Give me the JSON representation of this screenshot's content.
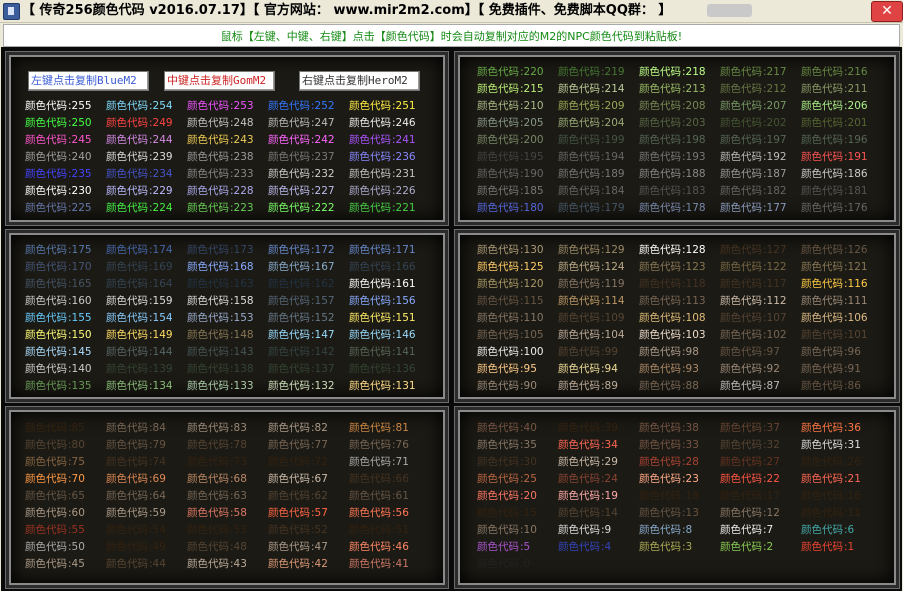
{
  "window": {
    "title": "【 传奇256颜色代码 v2016.07.17】【 官方网站：  www.mir2m2.com】【 免费插件、免费脚本QQ群：          】",
    "close_label": "✕"
  },
  "hint": "鼠标【左键、中键、右键】点击【颜色代码】时会自动复制对应的M2的NPC颜色代码到粘贴板!",
  "buttons": [
    {
      "label": "左键点击复制BlueM2"
    },
    {
      "label": "中键点击复制GomM2"
    },
    {
      "label": "右键点击复制HeroM2"
    }
  ],
  "code_prefix": "颜色代码",
  "color_codes": [
    {
      "value": 255,
      "color": "#ffffff"
    },
    {
      "value": 254,
      "color": "#7fdcff"
    },
    {
      "value": 253,
      "color": "#ee55ff"
    },
    {
      "value": 252,
      "color": "#3377ff"
    },
    {
      "value": 251,
      "color": "#ffee44"
    },
    {
      "value": 250,
      "color": "#44ff44"
    },
    {
      "value": 249,
      "color": "#ff4444"
    },
    {
      "value": 248,
      "color": "#c4c4c4"
    },
    {
      "value": 247,
      "color": "#bbbbbb"
    },
    {
      "value": 246,
      "color": "#eeeeee"
    },
    {
      "value": 245,
      "color": "#ff55cc"
    },
    {
      "value": 244,
      "color": "#d58ae6"
    },
    {
      "value": 243,
      "color": "#eecc55"
    },
    {
      "value": 242,
      "color": "#ff66ff"
    },
    {
      "value": 241,
      "color": "#aa55ff"
    },
    {
      "value": 240,
      "color": "#a0a0a0"
    },
    {
      "value": 239,
      "color": "#dddddd"
    },
    {
      "value": 238,
      "color": "#9a9a9a"
    },
    {
      "value": 237,
      "color": "#7a7a7a"
    },
    {
      "value": 236,
      "color": "#8888ff"
    },
    {
      "value": 235,
      "color": "#4444ff"
    },
    {
      "value": 234,
      "color": "#4455cc"
    },
    {
      "value": 233,
      "color": "#888888"
    },
    {
      "value": 232,
      "color": "#cccccc"
    },
    {
      "value": 231,
      "color": "#c4c4c4"
    },
    {
      "value": 230,
      "color": "#ffffff"
    },
    {
      "value": 229,
      "color": "#bbbbff"
    },
    {
      "value": 228,
      "color": "#aaaaee"
    },
    {
      "value": 227,
      "color": "#bbbbee"
    },
    {
      "value": 226,
      "color": "#aaaacc"
    },
    {
      "value": 225,
      "color": "#6677aa"
    },
    {
      "value": 224,
      "color": "#44ee44"
    },
    {
      "value": 223,
      "color": "#66cc55"
    },
    {
      "value": 222,
      "color": "#77ff66"
    },
    {
      "value": 221,
      "color": "#44cc44"
    },
    {
      "value": 220,
      "color": "#66aa44"
    },
    {
      "value": 219,
      "color": "#447733"
    },
    {
      "value": 218,
      "color": "#bbff88"
    },
    {
      "value": 217,
      "color": "#668844"
    },
    {
      "value": 216,
      "color": "#668844"
    },
    {
      "value": 215,
      "color": "#bbee77"
    },
    {
      "value": 214,
      "color": "#bbcc99"
    },
    {
      "value": 213,
      "color": "#99bb66"
    },
    {
      "value": 212,
      "color": "#667744"
    },
    {
      "value": 211,
      "color": "#889966"
    },
    {
      "value": 210,
      "color": "#aabb88"
    },
    {
      "value": 209,
      "color": "#99aa55"
    },
    {
      "value": 208,
      "color": "#778855"
    },
    {
      "value": 207,
      "color": "#779966"
    },
    {
      "value": 206,
      "color": "#aaee88"
    },
    {
      "value": 205,
      "color": "#889988"
    },
    {
      "value": 204,
      "color": "#99aa77"
    },
    {
      "value": 203,
      "color": "#556644"
    },
    {
      "value": 202,
      "color": "#445533"
    },
    {
      "value": 201,
      "color": "#556633"
    },
    {
      "value": 200,
      "color": "#778866"
    },
    {
      "value": 199,
      "color": "#445544"
    },
    {
      "value": 198,
      "color": "#556655"
    },
    {
      "value": 197,
      "color": "#556655"
    },
    {
      "value": 196,
      "color": "#556655"
    },
    {
      "value": 195,
      "color": "#444444"
    },
    {
      "value": 194,
      "color": "#666666"
    },
    {
      "value": 193,
      "color": "#777777"
    },
    {
      "value": 192,
      "color": "#bbbbbb"
    },
    {
      "value": 191,
      "color": "#ff5555"
    },
    {
      "value": 190,
      "color": "#666666"
    },
    {
      "value": 189,
      "color": "#777777"
    },
    {
      "value": 188,
      "color": "#888888"
    },
    {
      "value": 187,
      "color": "#999999"
    },
    {
      "value": 186,
      "color": "#cccccc"
    },
    {
      "value": 185,
      "color": "#777777"
    },
    {
      "value": 184,
      "color": "#666666"
    },
    {
      "value": 183,
      "color": "#555555"
    },
    {
      "value": 182,
      "color": "#666666"
    },
    {
      "value": 181,
      "color": "#555555"
    },
    {
      "value": 180,
      "color": "#5566dd"
    },
    {
      "value": 179,
      "color": "#445566"
    },
    {
      "value": 178,
      "color": "#7788aa"
    },
    {
      "value": 177,
      "color": "#8899bb"
    },
    {
      "value": 176,
      "color": "#666666"
    },
    {
      "value": 175,
      "color": "#5577aa"
    },
    {
      "value": 174,
      "color": "#4466aa"
    },
    {
      "value": 173,
      "color": "#334466"
    },
    {
      "value": 172,
      "color": "#6688cc"
    },
    {
      "value": 171,
      "color": "#6688cc"
    },
    {
      "value": 170,
      "color": "#445577"
    },
    {
      "value": 169,
      "color": "#334455"
    },
    {
      "value": 168,
      "color": "#88aaff"
    },
    {
      "value": 167,
      "color": "#88aacc"
    },
    {
      "value": 166,
      "color": "#334455"
    },
    {
      "value": 165,
      "color": "#445566"
    },
    {
      "value": 164,
      "color": "#334455"
    },
    {
      "value": 163,
      "color": "#223344"
    },
    {
      "value": 162,
      "color": "#223344"
    },
    {
      "value": 161,
      "color": "#ffffff"
    },
    {
      "value": 160,
      "color": "#cccccc"
    },
    {
      "value": 159,
      "color": "#dddddd"
    },
    {
      "value": 158,
      "color": "#dddddd"
    },
    {
      "value": 157,
      "color": "#556677"
    },
    {
      "value": 156,
      "color": "#88aaff"
    },
    {
      "value": 155,
      "color": "#66ccff"
    },
    {
      "value": 154,
      "color": "#88ccff"
    },
    {
      "value": 153,
      "color": "#99aacc"
    },
    {
      "value": 152,
      "color": "#667788"
    },
    {
      "value": 151,
      "color": "#ffee66"
    },
    {
      "value": 150,
      "color": "#ffff77"
    },
    {
      "value": 149,
      "color": "#ffdd66"
    },
    {
      "value": 148,
      "color": "#887755"
    },
    {
      "value": 147,
      "color": "#99ddff"
    },
    {
      "value": 146,
      "color": "#99ddff"
    },
    {
      "value": 145,
      "color": "#aaddff"
    },
    {
      "value": 144,
      "color": "#556666"
    },
    {
      "value": 143,
      "color": "#445555"
    },
    {
      "value": 142,
      "color": "#334444"
    },
    {
      "value": 141,
      "color": "#556655"
    },
    {
      "value": 140,
      "color": "#cccccc"
    },
    {
      "value": 139,
      "color": "#334433"
    },
    {
      "value": 138,
      "color": "#334433"
    },
    {
      "value": 137,
      "color": "#334433"
    },
    {
      "value": 136,
      "color": "#334433"
    },
    {
      "value": 135,
      "color": "#669955"
    },
    {
      "value": 134,
      "color": "#88bb77"
    },
    {
      "value": 133,
      "color": "#aaccaa"
    },
    {
      "value": 132,
      "color": "#ccddbb"
    },
    {
      "value": 131,
      "color": "#ffdd88"
    },
    {
      "value": 130,
      "color": "#aa9977"
    },
    {
      "value": 129,
      "color": "#998866"
    },
    {
      "value": 128,
      "color": "#ffffff"
    },
    {
      "value": 127,
      "color": "#443322"
    },
    {
      "value": 126,
      "color": "#665544"
    },
    {
      "value": 125,
      "color": "#ffcc66"
    },
    {
      "value": 124,
      "color": "#bbaa88"
    },
    {
      "value": 123,
      "color": "#887755"
    },
    {
      "value": 122,
      "color": "#776644"
    },
    {
      "value": 121,
      "color": "#887755"
    },
    {
      "value": 120,
      "color": "#aa9966"
    },
    {
      "value": 119,
      "color": "#887766"
    },
    {
      "value": 118,
      "color": "#443322"
    },
    {
      "value": 117,
      "color": "#443322"
    },
    {
      "value": 116,
      "color": "#ffcc44"
    },
    {
      "value": 115,
      "color": "#665544"
    },
    {
      "value": 114,
      "color": "#bb9966"
    },
    {
      "value": 113,
      "color": "#776655"
    },
    {
      "value": 112,
      "color": "#ccbbaa"
    },
    {
      "value": 111,
      "color": "#998877"
    },
    {
      "value": 110,
      "color": "#887766"
    },
    {
      "value": 109,
      "color": "#554433"
    },
    {
      "value": 108,
      "color": "#ddbb77"
    },
    {
      "value": 107,
      "color": "#554433"
    },
    {
      "value": 106,
      "color": "#ddbb88"
    },
    {
      "value": 105,
      "color": "#776655"
    },
    {
      "value": 104,
      "color": "#bbaa99"
    },
    {
      "value": 103,
      "color": "#eeddcc"
    },
    {
      "value": 102,
      "color": "#776655"
    },
    {
      "value": 101,
      "color": "#554433"
    },
    {
      "value": 100,
      "color": "#eeeeee"
    },
    {
      "value": 99,
      "color": "#554433"
    },
    {
      "value": 98,
      "color": "#aa9988"
    },
    {
      "value": 97,
      "color": "#665544"
    },
    {
      "value": 96,
      "color": "#776655"
    },
    {
      "value": 95,
      "color": "#ffcc88"
    },
    {
      "value": 94,
      "color": "#eedd99"
    },
    {
      "value": 93,
      "color": "#aa8866"
    },
    {
      "value": 92,
      "color": "#998877"
    },
    {
      "value": 91,
      "color": "#776655"
    },
    {
      "value": 90,
      "color": "#998877"
    },
    {
      "value": 89,
      "color": "#bbaa99"
    },
    {
      "value": 88,
      "color": "#776655"
    },
    {
      "value": 87,
      "color": "#bbbbbb"
    },
    {
      "value": 86,
      "color": "#665544"
    },
    {
      "value": 85,
      "color": "#332211"
    },
    {
      "value": 84,
      "color": "#776655"
    },
    {
      "value": 83,
      "color": "#998877"
    },
    {
      "value": 82,
      "color": "#aa9988"
    },
    {
      "value": 81,
      "color": "#cc8844"
    },
    {
      "value": 80,
      "color": "#554433"
    },
    {
      "value": 79,
      "color": "#665544"
    },
    {
      "value": 78,
      "color": "#554433"
    },
    {
      "value": 77,
      "color": "#776655"
    },
    {
      "value": 76,
      "color": "#776655"
    },
    {
      "value": 75,
      "color": "#886644"
    },
    {
      "value": 74,
      "color": "#443322"
    },
    {
      "value": 73,
      "color": "#332211"
    },
    {
      "value": 72,
      "color": "#332211"
    },
    {
      "value": 71,
      "color": "#aaaaaa"
    },
    {
      "value": 70,
      "color": "#ff9944"
    },
    {
      "value": 69,
      "color": "#dd8855"
    },
    {
      "value": 68,
      "color": "#bb8866"
    },
    {
      "value": 67,
      "color": "#ccbbaa"
    },
    {
      "value": 66,
      "color": "#443322"
    },
    {
      "value": 65,
      "color": "#665544"
    },
    {
      "value": 64,
      "color": "#776655"
    },
    {
      "value": 63,
      "color": "#776655"
    },
    {
      "value": 62,
      "color": "#554433"
    },
    {
      "value": 61,
      "color": "#665544"
    },
    {
      "value": 60,
      "color": "#aa9988"
    },
    {
      "value": 59,
      "color": "#aa9988"
    },
    {
      "value": 58,
      "color": "#dd7766"
    },
    {
      "value": 57,
      "color": "#ff6644"
    },
    {
      "value": 56,
      "color": "#ff7755"
    },
    {
      "value": 55,
      "color": "#993322"
    },
    {
      "value": 54,
      "color": "#332211"
    },
    {
      "value": 53,
      "color": "#332211"
    },
    {
      "value": 52,
      "color": "#443322"
    },
    {
      "value": 51,
      "color": "#332211"
    },
    {
      "value": 50,
      "color": "#aaaaaa"
    },
    {
      "value": 49,
      "color": "#332211"
    },
    {
      "value": 48,
      "color": "#554433"
    },
    {
      "value": 47,
      "color": "#aa9988"
    },
    {
      "value": 46,
      "color": "#ff8866"
    },
    {
      "value": 45,
      "color": "#aa9988"
    },
    {
      "value": 44,
      "color": "#554433"
    },
    {
      "value": 43,
      "color": "#bbaa99"
    },
    {
      "value": 42,
      "color": "#dd9977"
    },
    {
      "value": 41,
      "color": "#cc7766"
    },
    {
      "value": 40,
      "color": "#775544"
    },
    {
      "value": 39,
      "color": "#332211"
    },
    {
      "value": 38,
      "color": "#775544"
    },
    {
      "value": 37,
      "color": "#664433"
    },
    {
      "value": 36,
      "color": "#ff7744"
    },
    {
      "value": 35,
      "color": "#887766"
    },
    {
      "value": 34,
      "color": "#ff6655"
    },
    {
      "value": 33,
      "color": "#775544"
    },
    {
      "value": 32,
      "color": "#554433"
    },
    {
      "value": 31,
      "color": "#dddddd"
    },
    {
      "value": 30,
      "color": "#443322"
    },
    {
      "value": 29,
      "color": "#ccbbaa"
    },
    {
      "value": 28,
      "color": "#aa4433"
    },
    {
      "value": 27,
      "color": "#663322"
    },
    {
      "value": 26,
      "color": "#332211"
    },
    {
      "value": 25,
      "color": "#bb6644"
    },
    {
      "value": 24,
      "color": "#884433"
    },
    {
      "value": 23,
      "color": "#ffaa88"
    },
    {
      "value": 22,
      "color": "#ff5544"
    },
    {
      "value": 21,
      "color": "#ff6655"
    },
    {
      "value": 20,
      "color": "#ff7766"
    },
    {
      "value": 19,
      "color": "#ffaaaa"
    },
    {
      "value": 18,
      "color": "#332211"
    },
    {
      "value": 17,
      "color": "#332211"
    },
    {
      "value": 16,
      "color": "#332211"
    },
    {
      "value": 15,
      "color": "#332211"
    },
    {
      "value": 14,
      "color": "#554433"
    },
    {
      "value": 13,
      "color": "#665544"
    },
    {
      "value": 12,
      "color": "#887766"
    },
    {
      "value": 11,
      "color": "#332211"
    },
    {
      "value": 10,
      "color": "#887766"
    },
    {
      "value": 9,
      "color": "#dddddd"
    },
    {
      "value": 8,
      "color": "#88aacc"
    },
    {
      "value": 7,
      "color": "#eeeeee"
    },
    {
      "value": 6,
      "color": "#44aaaa"
    },
    {
      "value": 5,
      "color": "#aa55cc"
    },
    {
      "value": 4,
      "color": "#3344bb"
    },
    {
      "value": 3,
      "color": "#aaaa55"
    },
    {
      "value": 2,
      "color": "#88cc55"
    },
    {
      "value": 1,
      "color": "#ee4433"
    },
    {
      "value": 0,
      "color": "#222222"
    }
  ]
}
